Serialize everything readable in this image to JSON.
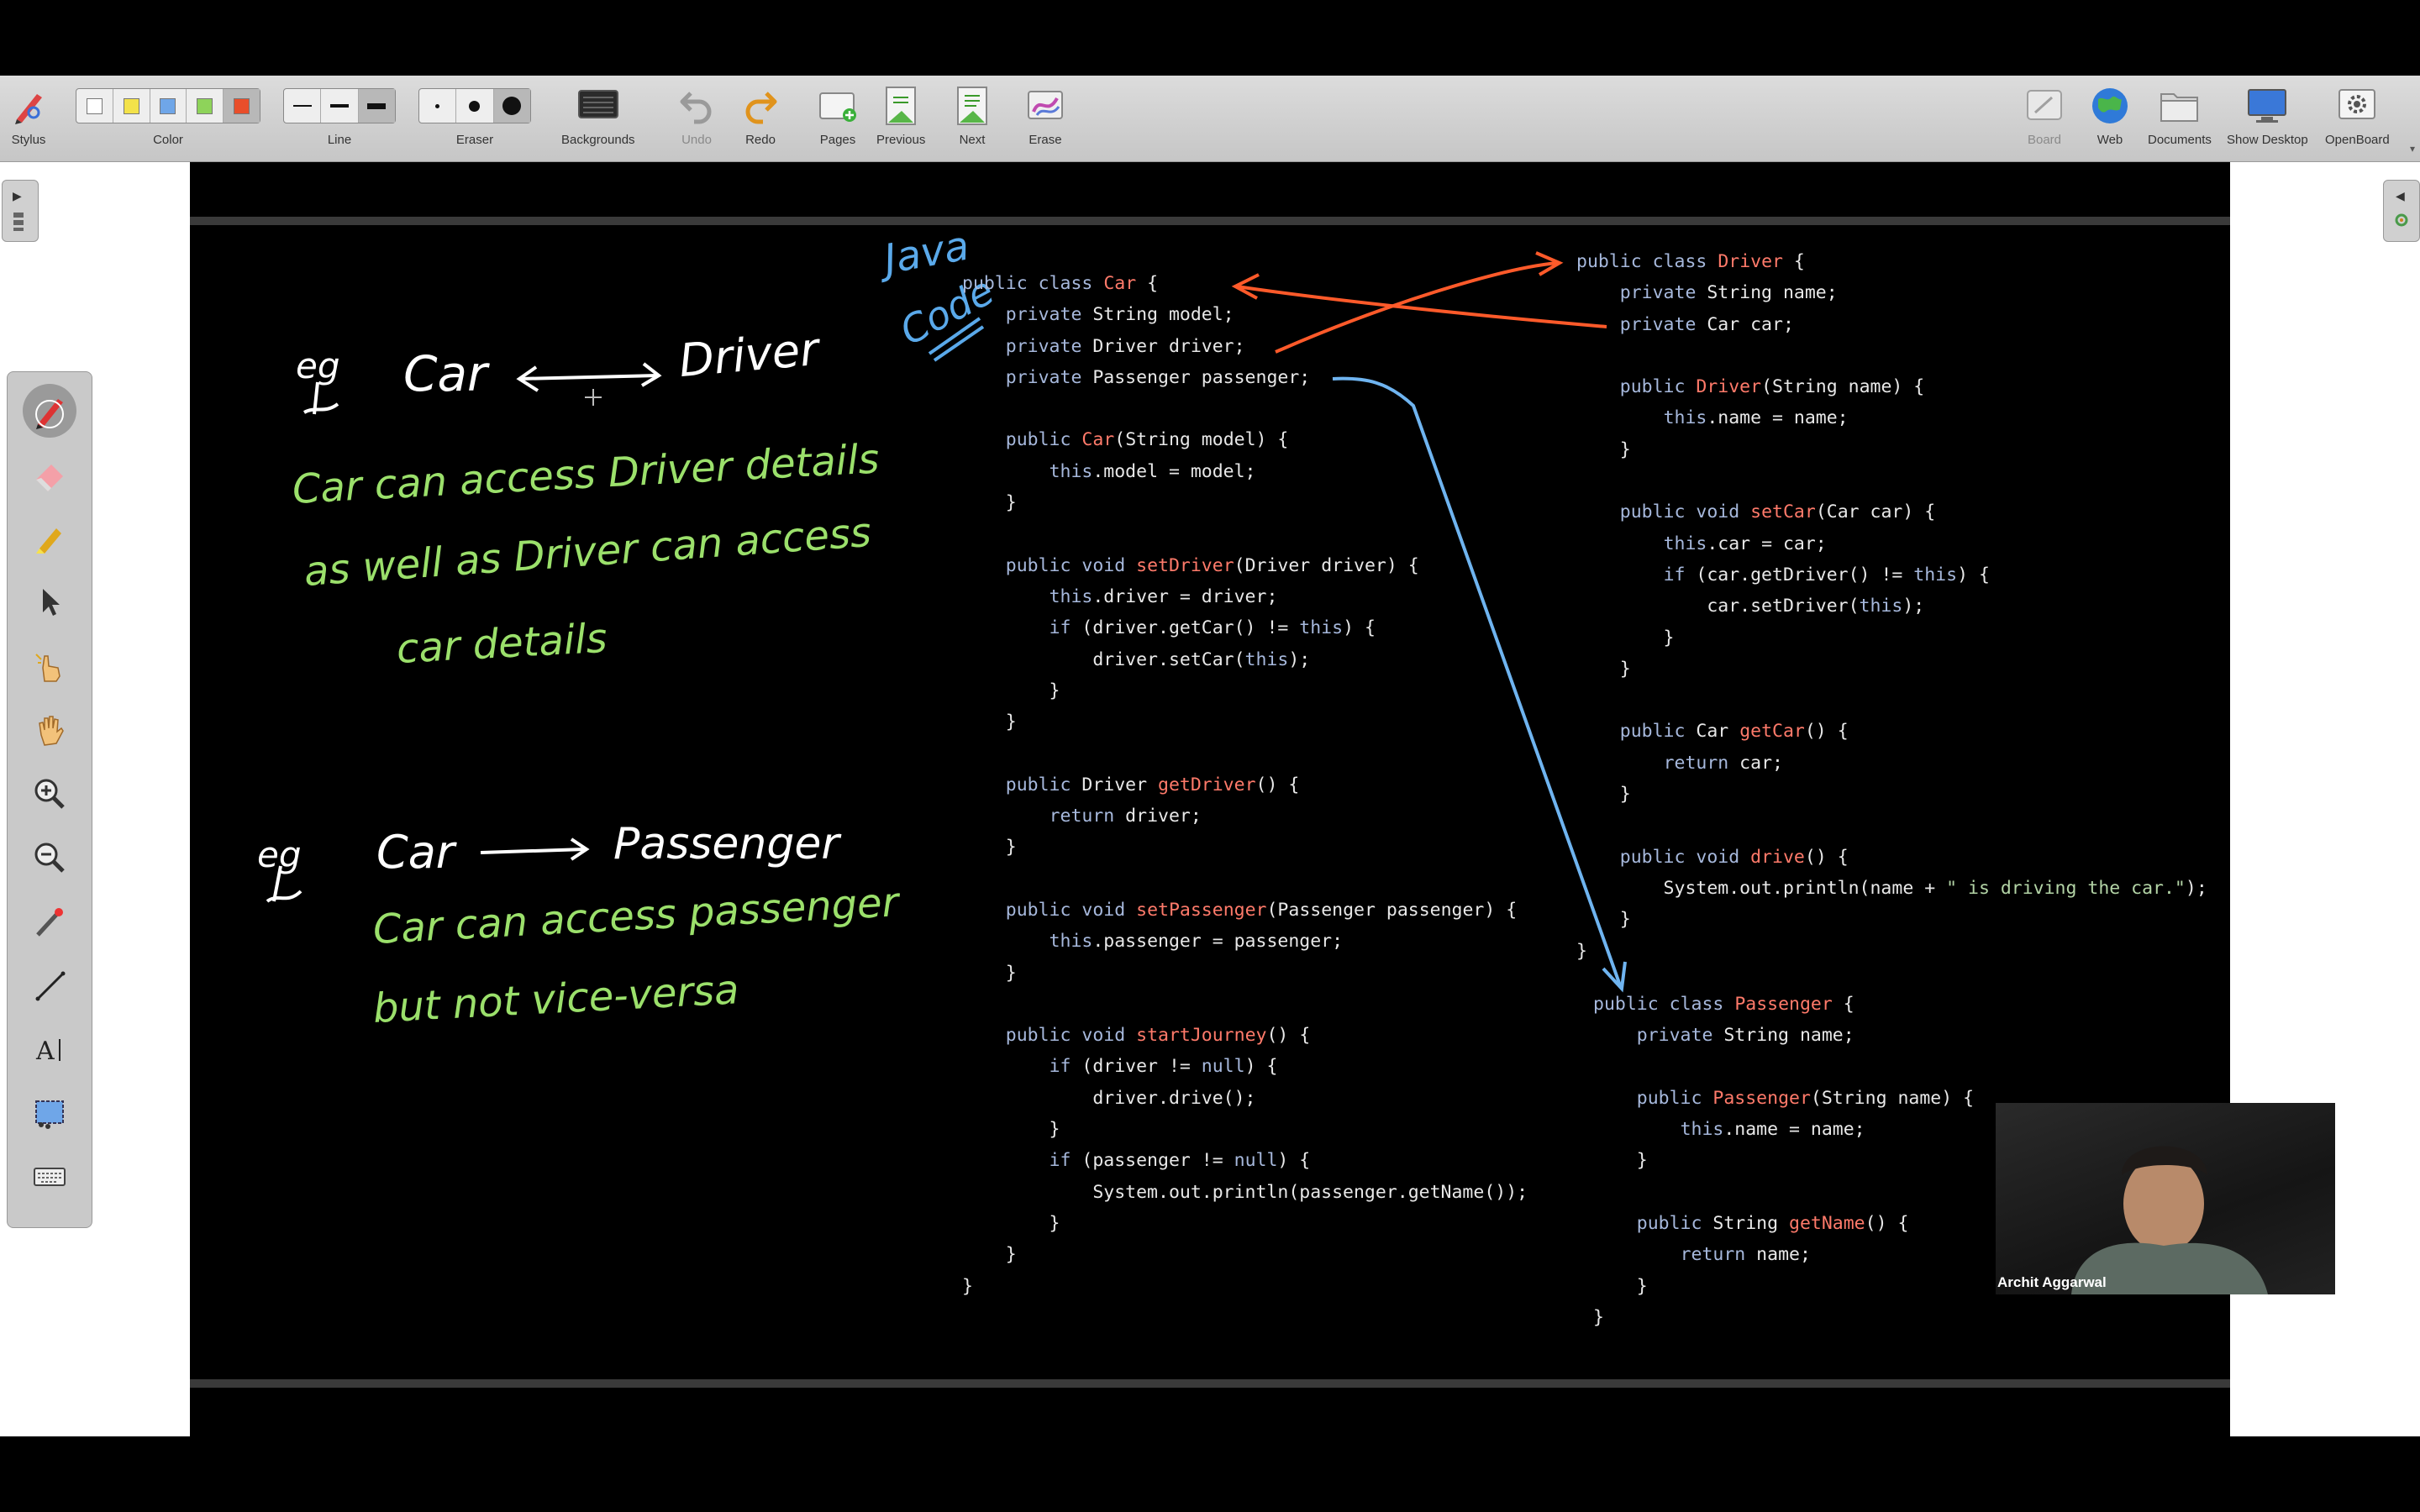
{
  "toolbar": {
    "stylus": "Stylus",
    "color": "Color",
    "line": "Line",
    "eraser": "Eraser",
    "backgrounds": "Backgrounds",
    "undo": "Undo",
    "redo": "Redo",
    "pages": "Pages",
    "previous": "Previous",
    "next": "Next",
    "erase": "Erase",
    "board": "Board",
    "web": "Web",
    "documents": "Documents",
    "show_desktop": "Show Desktop",
    "openboard": "OpenBoard"
  },
  "colors": {
    "white": "#ffffff",
    "yellow": "#f3e24a",
    "blue": "#6fa6e8",
    "green": "#8ed35a",
    "red": "#e94e2a",
    "accent_handwriting_green": "#9be06b",
    "accent_handwriting_blue": "#5aa9ea",
    "arrow_red": "#ff5a2a",
    "arrow_blue": "#6fb4f0"
  },
  "handwriting": {
    "java": "Java",
    "code": "Code",
    "eg1": "eg",
    "car1": "Car",
    "driver": "Driver",
    "line1": "Car can access Driver details",
    "line2": "as well as  Driver can access",
    "line3": "car details",
    "eg2": "eg",
    "car2": "Car",
    "passenger": "Passenger",
    "line4": "Car can access passenger",
    "line5": "but not vice-versa"
  },
  "video": {
    "name": "Archit Aggarwal"
  },
  "code_car": [
    "public class Car {",
    "    private String model;",
    "    private Driver driver;",
    "    private Passenger passenger;",
    "",
    "    public Car(String model) {",
    "        this.model = model;",
    "    }",
    "",
    "    public void setDriver(Driver driver) {",
    "        this.driver = driver;",
    "        if (driver.getCar() != this) {",
    "            driver.setCar(this);",
    "        }",
    "    }",
    "",
    "    public Driver getDriver() {",
    "        return driver;",
    "    }",
    "",
    "    public void setPassenger(Passenger passenger) {",
    "        this.passenger = passenger;",
    "    }",
    "",
    "    public void startJourney() {",
    "        if (driver != null) {",
    "            driver.drive();",
    "        }",
    "        if (passenger != null) {",
    "            System.out.println(passenger.getName());",
    "        }",
    "    }",
    "}"
  ],
  "code_driver": [
    "public class Driver {",
    "    private String name;",
    "    private Car car;",
    "",
    "    public Driver(String name) {",
    "        this.name = name;",
    "    }",
    "",
    "    public void setCar(Car car) {",
    "        this.car = car;",
    "        if (car.getDriver() != this) {",
    "            car.setDriver(this);",
    "        }",
    "    }",
    "",
    "    public Car getCar() {",
    "        return car;",
    "    }",
    "",
    "    public void drive() {",
    "        System.out.println(name + \" is driving the car.\");",
    "    }",
    "}"
  ],
  "code_passenger": [
    "public class Passenger {",
    "    private String name;",
    "",
    "    public Passenger(String name) {",
    "        this.name = name;",
    "    }",
    "",
    "    public String getName() {",
    "        return name;",
    "    }",
    "}"
  ]
}
